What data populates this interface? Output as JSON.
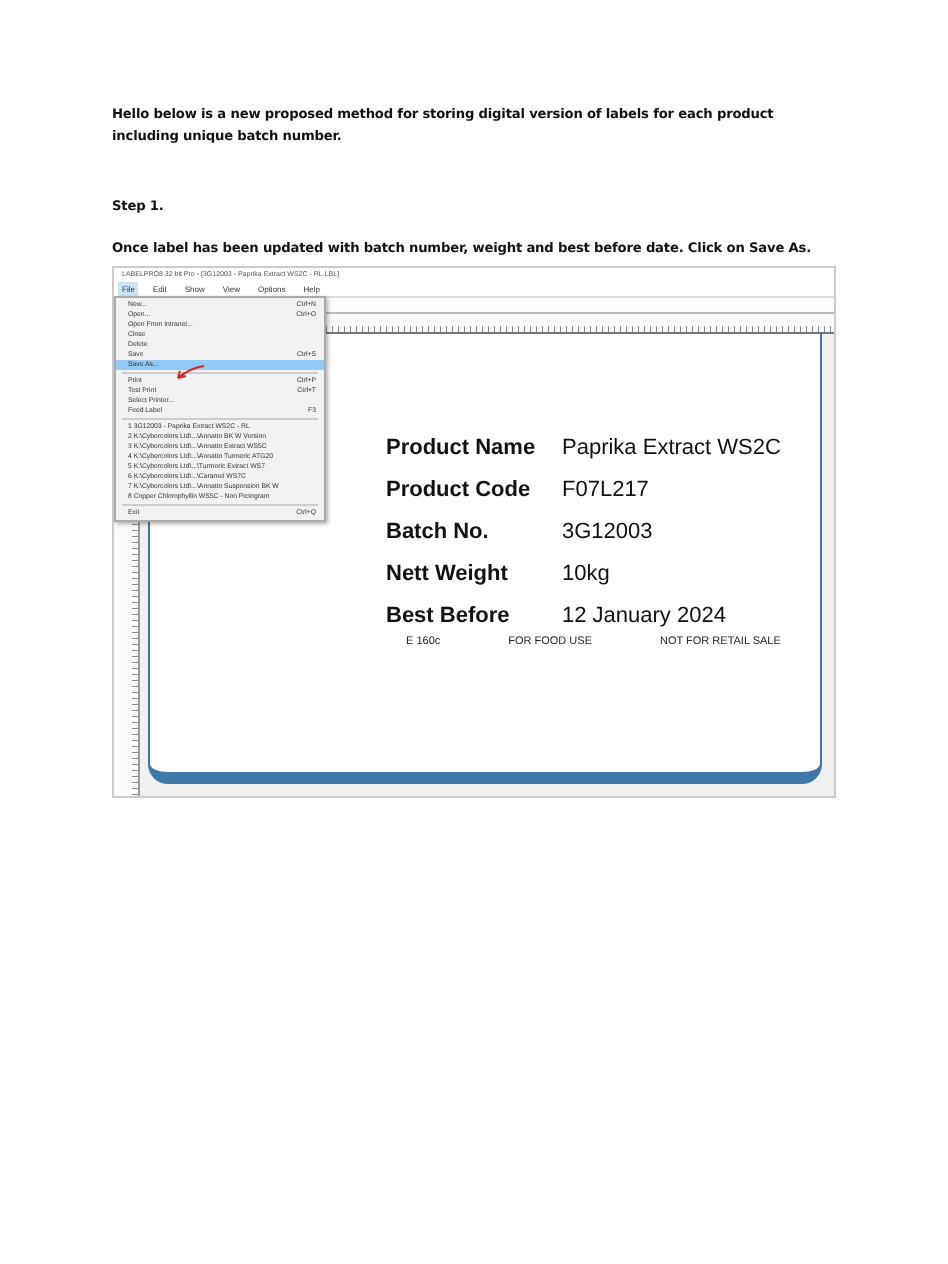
{
  "intro": "Hello below is a new proposed method for storing digital version of labels for each product including unique batch number.",
  "step": {
    "heading": "Step 1.",
    "instruction": "Once label has been updated with batch number, weight and best before date. Click on Save As."
  },
  "app": {
    "title": "LABELPRO8 32 bit Pro - [3G12003 - Paprika Extract WS2C - RL.LBL]",
    "menu_bar": [
      {
        "label": "File",
        "selected": true
      },
      {
        "label": "Edit",
        "selected": false
      },
      {
        "label": "Show",
        "selected": false
      },
      {
        "label": "View",
        "selected": false
      },
      {
        "label": "Options",
        "selected": false
      },
      {
        "label": "Help",
        "selected": false
      }
    ],
    "file_menu": [
      {
        "kind": "item",
        "label": "New...",
        "shortcut": "Ctrl+N",
        "selected": false
      },
      {
        "kind": "item",
        "label": "Open...",
        "shortcut": "Ctrl+O",
        "selected": false
      },
      {
        "kind": "item",
        "label": "Open From Intranet...",
        "selected": false
      },
      {
        "kind": "item",
        "label": "Close",
        "selected": false
      },
      {
        "kind": "item",
        "label": "Delete",
        "selected": false
      },
      {
        "kind": "item",
        "label": "Save",
        "shortcut": "Ctrl+S",
        "selected": false
      },
      {
        "kind": "item",
        "label": "Save As...",
        "selected": true
      },
      {
        "kind": "separator"
      },
      {
        "kind": "item",
        "label": "Print",
        "shortcut": "Ctrl+P",
        "selected": false
      },
      {
        "kind": "item",
        "label": "Test Print",
        "shortcut": "Ctrl+T",
        "selected": false
      },
      {
        "kind": "item",
        "label": "Select Printer...",
        "selected": false
      },
      {
        "kind": "item",
        "label": "Feed Label",
        "shortcut": "F3",
        "selected": false
      },
      {
        "kind": "separator"
      },
      {
        "kind": "item",
        "label": "1 3G12003 - Paprika Extract WS2C - RL",
        "selected": false
      },
      {
        "kind": "item",
        "label": "2 K:\\Cybercolors Ltd\\...\\Annatto BK W Version",
        "selected": false
      },
      {
        "kind": "item",
        "label": "3 K:\\Cybercolors Ltd\\...\\Annatto Extract WS5C",
        "selected": false
      },
      {
        "kind": "item",
        "label": "4 K:\\Cybercolors Ltd\\...\\Annatto Turmeric ATG20",
        "selected": false
      },
      {
        "kind": "item",
        "label": "5 K:\\Cybercolors Ltd\\...\\Turmeric Extract WS7",
        "selected": false
      },
      {
        "kind": "item",
        "label": "6 K:\\Cybercolors Ltd\\...\\Caramel WS7C",
        "selected": false
      },
      {
        "kind": "item",
        "label": "7 K:\\Cybercolors Ltd\\...\\Annatto Suspension BK W",
        "selected": false
      },
      {
        "kind": "item",
        "label": "8 Copper Chlorophyllin WS5C - Non Pictogram",
        "selected": false
      },
      {
        "kind": "separator"
      },
      {
        "kind": "item",
        "label": "Exit",
        "shortcut": "Ctrl+Q",
        "selected": false
      }
    ],
    "label": {
      "fields": [
        {
          "name": "Product Name",
          "value": "Paprika Extract WS2C"
        },
        {
          "name": "Product Code",
          "value": "F07L217"
        },
        {
          "name": "Batch No.",
          "value": "3G12003"
        },
        {
          "name": "Nett Weight",
          "value": "10kg"
        },
        {
          "name": "Best Before",
          "value": "12 January 2024"
        }
      ],
      "footer": [
        "E 160c",
        "FOR FOOD USE",
        "NOT FOR RETAIL SALE"
      ]
    }
  }
}
